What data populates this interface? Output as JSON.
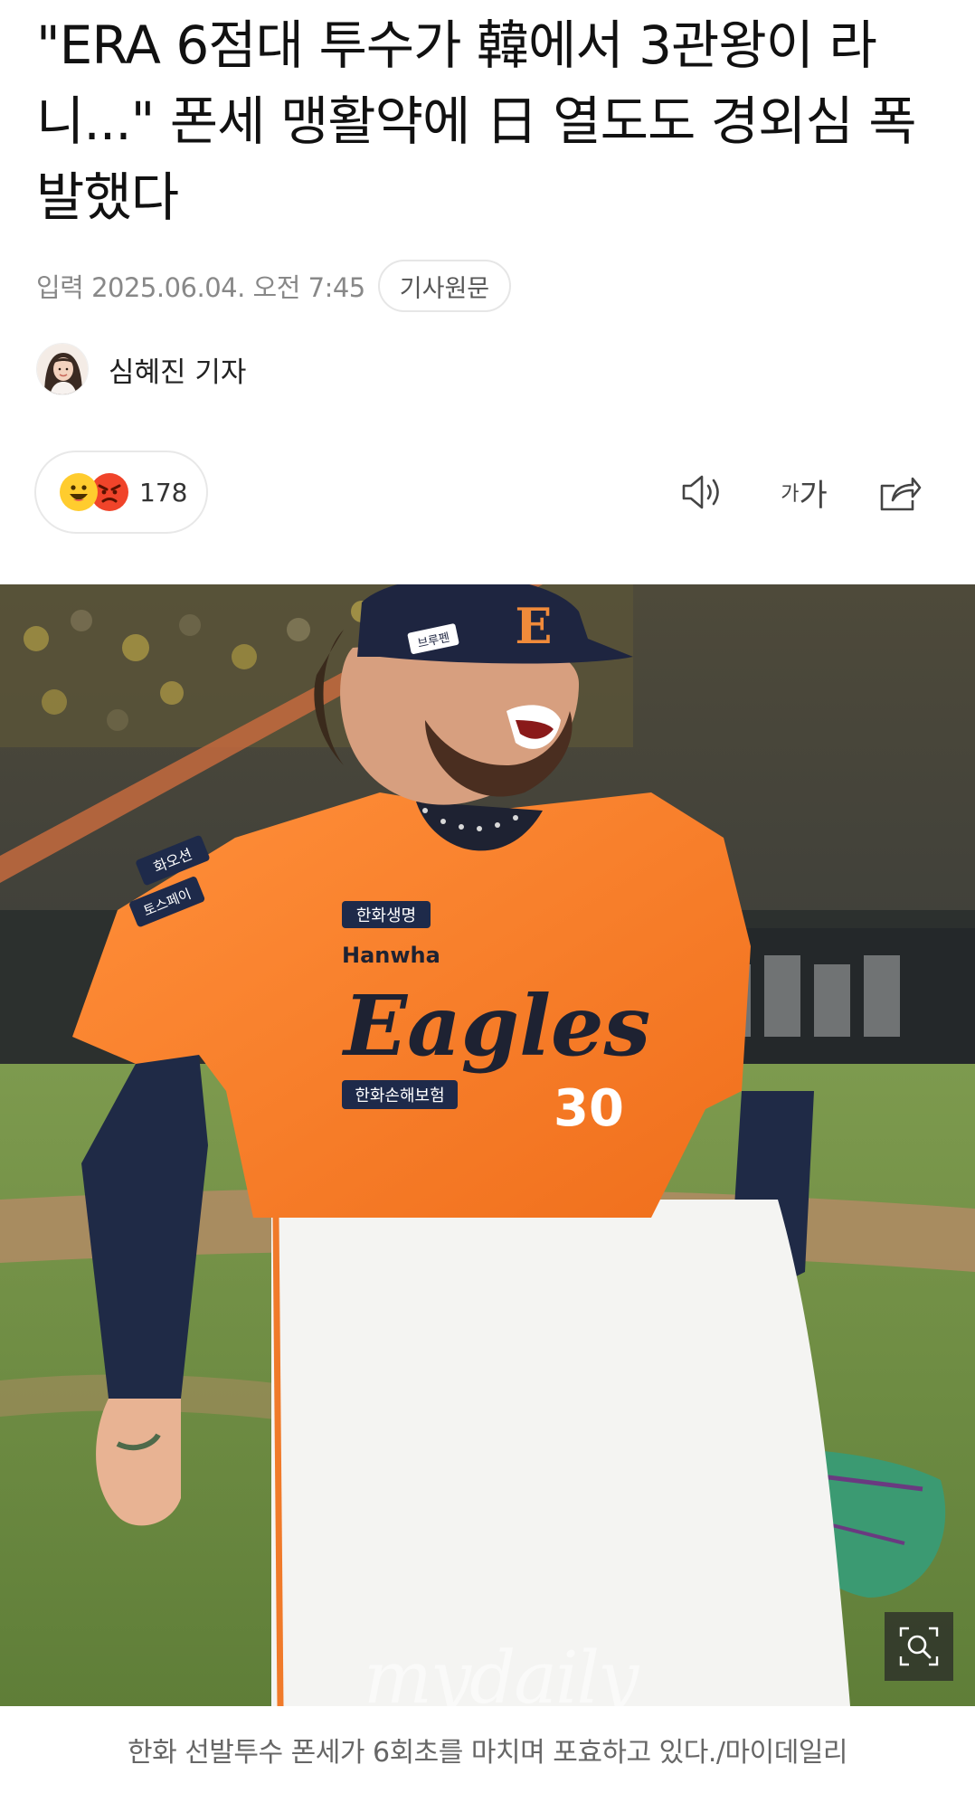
{
  "article": {
    "headline": "\"ERA 6점대 투수가 韓에서 3관왕이 라니...\" 폰세 맹활약에 日 열도도 경외심 폭발했다",
    "date": "입력 2025.06.04. 오전 7:45",
    "original_link_label": "기사원문",
    "author": "심혜진 기자"
  },
  "reactions": {
    "count": "178",
    "icons": [
      "happy-face",
      "angry-face"
    ]
  },
  "toolbar": {
    "audio_icon": "speaker-icon",
    "font_small": "가",
    "font_big": "가",
    "share_icon": "share-icon"
  },
  "photo": {
    "watermark": "mydaily",
    "cap_logo": "E",
    "jersey_wordmark": "Eagles",
    "jersey_brand": "Hanwha",
    "jersey_number": "30",
    "jersey_patch_top": "한화생명",
    "jersey_patch_bottom": "한화손해보험",
    "sleeve_patch_1": "화오션",
    "sleeve_patch_2": "토스페이",
    "cap_side_patch": "브루펜",
    "zoom_icon": "zoom-search-icon"
  },
  "caption": "한화 선발투수 폰세가 6회초를 마치며 포효하고 있다./마이데일리"
}
